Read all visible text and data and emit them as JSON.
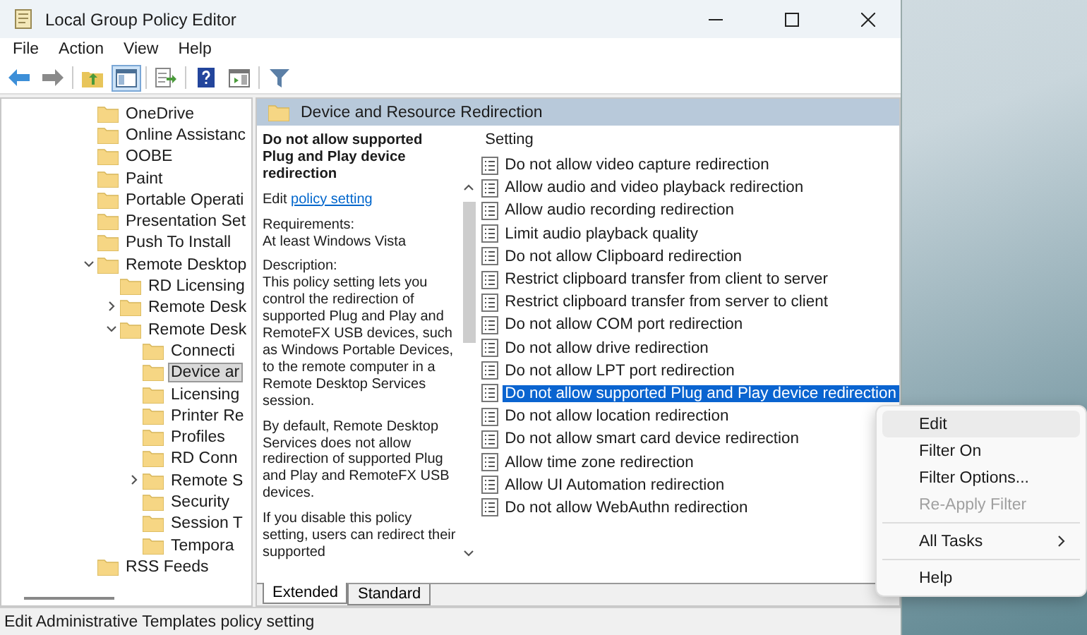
{
  "window": {
    "title": "Local Group Policy Editor"
  },
  "menu": [
    "File",
    "Action",
    "View",
    "Help"
  ],
  "toolbar": [
    {
      "kind": "back",
      "pressed": false
    },
    {
      "kind": "forward",
      "pressed": false
    },
    {
      "kind": "up",
      "pressed": false
    },
    {
      "kind": "tree",
      "pressed": true
    },
    {
      "kind": "export",
      "pressed": false
    },
    {
      "kind": "help",
      "pressed": false
    },
    {
      "kind": "panel",
      "pressed": false
    },
    {
      "kind": "filter",
      "pressed": false
    }
  ],
  "tree": [
    {
      "label": "OneDrive",
      "selected": false
    },
    {
      "label": "Online Assistanc",
      "selected": false
    },
    {
      "label": "OOBE",
      "selected": false
    },
    {
      "label": "Paint",
      "selected": false
    },
    {
      "label": "Portable Operati",
      "selected": false
    },
    {
      "label": "Presentation Set",
      "selected": false
    },
    {
      "label": "Push To Install",
      "selected": false
    },
    {
      "label": "Remote Desktop",
      "selected": false,
      "expanded": true,
      "children": [
        {
          "label": "RD Licensing",
          "selected": false
        },
        {
          "label": "Remote Desk",
          "selected": false,
          "expanded": false
        },
        {
          "label": "Remote Desk",
          "selected": false,
          "expanded": true,
          "children": [
            {
              "label": "Connecti",
              "selected": false
            },
            {
              "label": "Device ar",
              "selected": true
            },
            {
              "label": "Licensing",
              "selected": false
            },
            {
              "label": "Printer Re",
              "selected": false
            },
            {
              "label": "Profiles",
              "selected": false
            },
            {
              "label": "RD Conn",
              "selected": false
            },
            {
              "label": "Remote S",
              "selected": false,
              "expanded": false
            },
            {
              "label": "Security",
              "selected": false
            },
            {
              "label": "Session T",
              "selected": false
            },
            {
              "label": "Tempora",
              "selected": false
            }
          ]
        }
      ]
    },
    {
      "label": "RSS Feeds",
      "selected": false
    }
  ],
  "header": {
    "title": "Device and Resource Redirection"
  },
  "description": {
    "title": "Do not allow supported Plug and Play device redirection",
    "edit_prefix": "Edit",
    "edit_link": "policy setting ",
    "paragraphs": [
      "Requirements:\nAt least Windows Vista",
      "Description:\nThis policy setting lets you control the redirection of supported Plug and Play and RemoteFX USB devices, such as Windows Portable Devices, to the remote computer in a Remote Desktop Services session.",
      "By default, Remote Desktop Services does not allow redirection of supported Plug and Play and RemoteFX USB devices.",
      "If you disable this policy setting, users can redirect their supported"
    ]
  },
  "settings": {
    "column": "Setting",
    "rows": [
      {
        "label": "Do not allow video capture redirection",
        "selected": false
      },
      {
        "label": "Allow audio and video playback redirection",
        "selected": false
      },
      {
        "label": "Allow audio recording redirection",
        "selected": false
      },
      {
        "label": "Limit audio playback quality",
        "selected": false
      },
      {
        "label": "Do not allow Clipboard redirection",
        "selected": false
      },
      {
        "label": "Restrict clipboard transfer from client to server",
        "selected": false
      },
      {
        "label": "Restrict clipboard transfer from server to client",
        "selected": false
      },
      {
        "label": "Do not allow COM port redirection",
        "selected": false
      },
      {
        "label": "Do not allow drive redirection",
        "selected": false
      },
      {
        "label": "Do not allow LPT port redirection",
        "selected": false
      },
      {
        "label": "Do not allow supported Plug and Play device redirection",
        "selected": true
      },
      {
        "label": "Do not allow location redirection",
        "selected": false
      },
      {
        "label": "Do not allow smart card device redirection",
        "selected": false
      },
      {
        "label": "Allow time zone redirection",
        "selected": false
      },
      {
        "label": "Allow UI Automation redirection",
        "selected": false
      },
      {
        "label": "Do not allow WebAuthn redirection",
        "selected": false
      }
    ]
  },
  "tabs": [
    {
      "label": "Extended",
      "selected": true
    },
    {
      "label": "Standard",
      "selected": false
    }
  ],
  "status_bar": "Edit Administrative Templates policy setting",
  "context_menu": [
    {
      "kind": "item",
      "label": "Edit",
      "hovered": true,
      "disabled": false
    },
    {
      "kind": "item",
      "label": "Filter On",
      "hovered": false,
      "disabled": false
    },
    {
      "kind": "item",
      "label": "Filter Options...",
      "hovered": false,
      "disabled": false
    },
    {
      "kind": "item",
      "label": "Re-Apply Filter",
      "hovered": false,
      "disabled": true
    },
    {
      "kind": "separator"
    },
    {
      "kind": "submenu",
      "label": "All Tasks",
      "hovered": false,
      "disabled": false
    },
    {
      "kind": "separator"
    },
    {
      "kind": "item",
      "label": "Help",
      "hovered": false,
      "disabled": false
    }
  ]
}
